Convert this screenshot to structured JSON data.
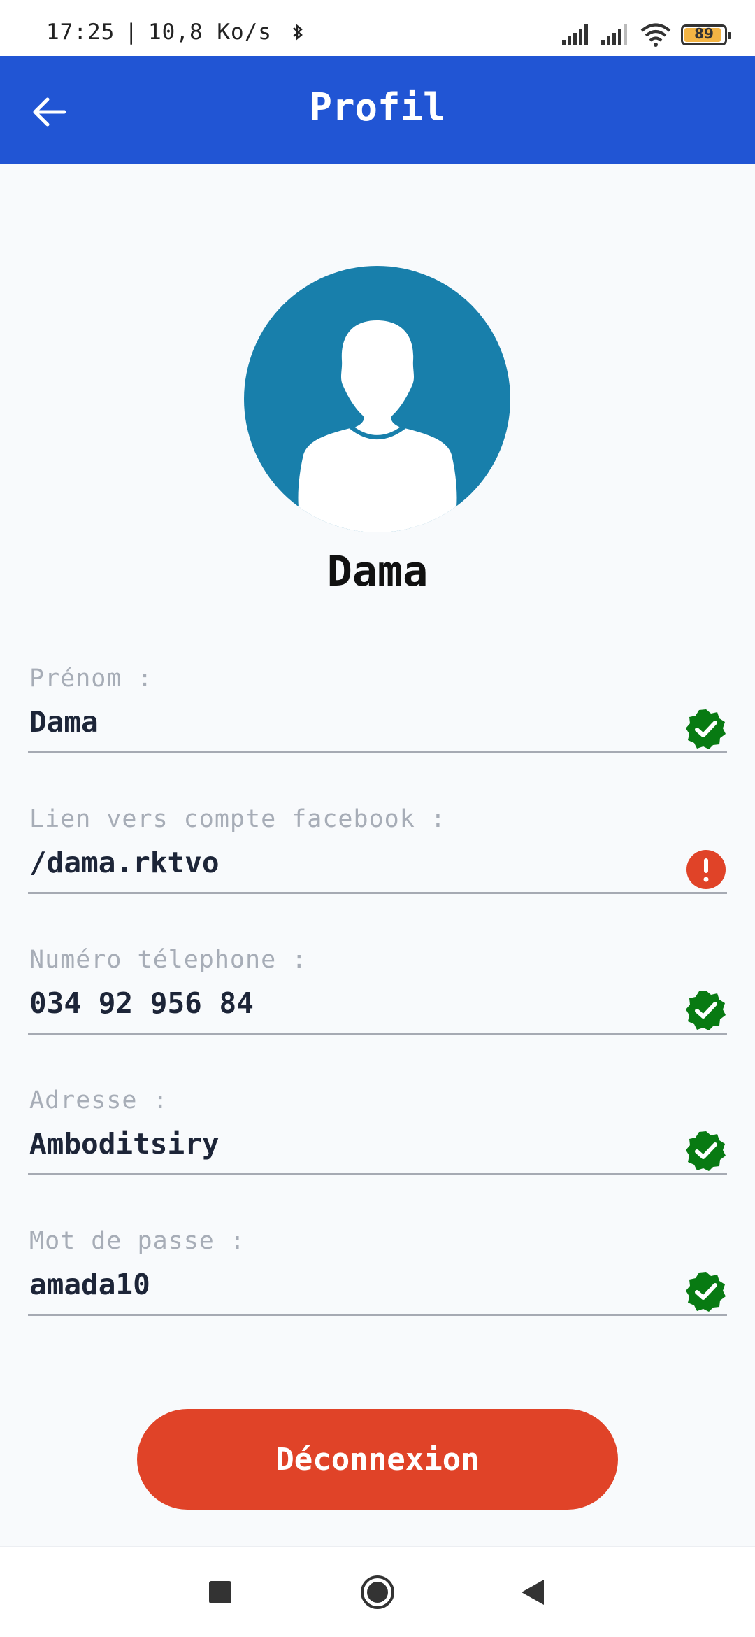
{
  "status_bar": {
    "time": "17:25",
    "separator": "|",
    "network_speed": "10,8 Ko/s",
    "battery_level": "89",
    "icons": [
      "bluetooth-icon",
      "signal-icon",
      "signal-icon",
      "wifi-icon",
      "battery-icon"
    ]
  },
  "app_bar": {
    "title": "Profil",
    "back_icon": "arrow-left-icon",
    "color": "#2155d4"
  },
  "profile": {
    "name": "Dama",
    "avatar_icon": "user-silhouette-icon",
    "avatar_color": "#187fab"
  },
  "fields": [
    {
      "label": "Prénom :",
      "value": "Dama",
      "status": "valid"
    },
    {
      "label": "Lien vers compte facebook :",
      "value": "/dama.rktvo",
      "status": "error"
    },
    {
      "label": "Numéro télephone :",
      "value": "034 92 956 84",
      "status": "valid"
    },
    {
      "label": "Adresse :",
      "value": "Amboditsiry",
      "status": "valid"
    },
    {
      "label": "Mot de passe :",
      "value": "amada10",
      "status": "valid"
    }
  ],
  "status_colors": {
    "valid": "#087a12",
    "error": "#e04328"
  },
  "logout_button": {
    "label": "Déconnexion",
    "color": "#e04328"
  },
  "nav_bar": {
    "items": [
      "recent-apps-icon",
      "home-icon",
      "back-icon"
    ]
  }
}
